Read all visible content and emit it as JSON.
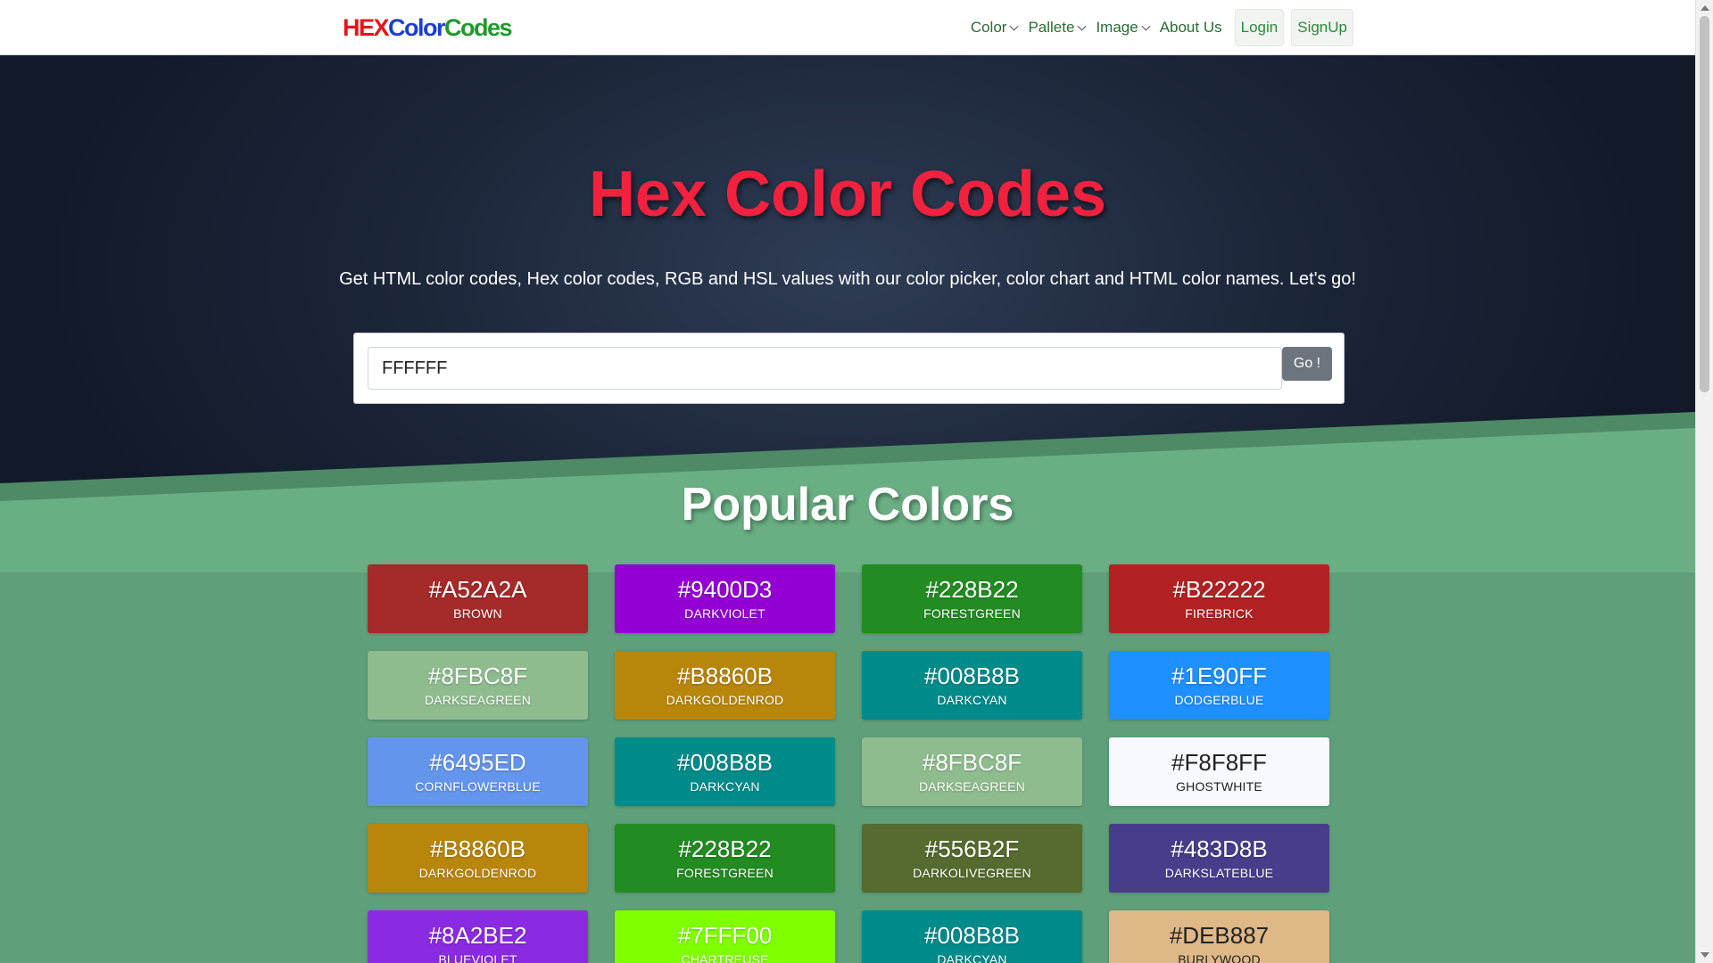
{
  "brand": {
    "part1": "HEX",
    "part2": "Color",
    "part3": "Codes"
  },
  "nav": {
    "items": [
      {
        "label": "Color",
        "dropdown": true
      },
      {
        "label": "Pallete",
        "dropdown": true
      },
      {
        "label": "Image",
        "dropdown": true
      },
      {
        "label": "About Us",
        "dropdown": false
      }
    ],
    "login": "Login",
    "signup": "SignUp"
  },
  "hero": {
    "title": "Hex Color Codes",
    "subtitle": "Get HTML color codes, Hex color codes, RGB and HSL values with our color picker, color chart and HTML color names. Let's go!",
    "search_value": "FFFFFF",
    "go_label": "Go !"
  },
  "popular": {
    "title": "Popular Colors",
    "colors": [
      {
        "hex": "#A52A2A",
        "name": "BROWN",
        "color": "#A52A2A",
        "light": false
      },
      {
        "hex": "#9400D3",
        "name": "DARKVIOLET",
        "color": "#9400D3",
        "light": false
      },
      {
        "hex": "#228B22",
        "name": "FORESTGREEN",
        "color": "#228B22",
        "light": false
      },
      {
        "hex": "#B22222",
        "name": "FIREBRICK",
        "color": "#B22222",
        "light": false
      },
      {
        "hex": "#8FBC8F",
        "name": "DARKSEAGREEN",
        "color": "#8FBC8F",
        "light": false
      },
      {
        "hex": "#B8860B",
        "name": "DARKGOLDENROD",
        "color": "#B8860B",
        "light": false
      },
      {
        "hex": "#008B8B",
        "name": "DARKCYAN",
        "color": "#008B8B",
        "light": false
      },
      {
        "hex": "#1E90FF",
        "name": "DODGERBLUE",
        "color": "#1E90FF",
        "light": false
      },
      {
        "hex": "#6495ED",
        "name": "CORNFLOWERBLUE",
        "color": "#6495ED",
        "light": false
      },
      {
        "hex": "#008B8B",
        "name": "DARKCYAN",
        "color": "#008B8B",
        "light": false
      },
      {
        "hex": "#8FBC8F",
        "name": "DARKSEAGREEN",
        "color": "#8FBC8F",
        "light": false
      },
      {
        "hex": "#F8F8FF",
        "name": "GHOSTWHITE",
        "color": "#F8F8FF",
        "light": true
      },
      {
        "hex": "#B8860B",
        "name": "DARKGOLDENROD",
        "color": "#B8860B",
        "light": false
      },
      {
        "hex": "#228B22",
        "name": "FORESTGREEN",
        "color": "#228B22",
        "light": false
      },
      {
        "hex": "#556B2F",
        "name": "DARKOLIVEGREEN",
        "color": "#556B2F",
        "light": false
      },
      {
        "hex": "#483D8B",
        "name": "DARKSLATEBLUE",
        "color": "#483D8B",
        "light": false
      },
      {
        "hex": "#8A2BE2",
        "name": "BLUEVIOLET",
        "color": "#8A2BE2",
        "light": false
      },
      {
        "hex": "#7FFF00",
        "name": "CHARTREUSE",
        "color": "#7FFF00",
        "light": false
      },
      {
        "hex": "#008B8B",
        "name": "DARKCYAN",
        "color": "#008B8B",
        "light": false
      },
      {
        "hex": "#DEB887",
        "name": "BURLYWOOD",
        "color": "#DEB887",
        "light": true
      }
    ]
  },
  "colors": {
    "hero_bg": "#1c2639",
    "title_red": "#f2223f",
    "green_bg": "#5f9f7a"
  }
}
